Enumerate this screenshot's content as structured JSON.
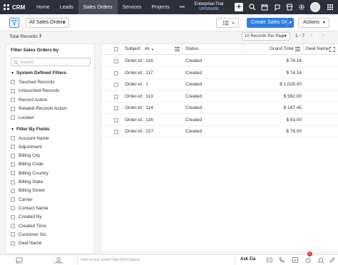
{
  "app": {
    "name": "CRM"
  },
  "nav": {
    "tabs": [
      {
        "label": "Home"
      },
      {
        "label": "Leads"
      },
      {
        "label": "Sales Orders"
      },
      {
        "label": "Services"
      },
      {
        "label": "Projects"
      },
      {
        "label": "•••"
      }
    ],
    "active_tab": "Sales Orders"
  },
  "trial": {
    "line1": "Enterprise-Trial",
    "line2": "UPGRADE"
  },
  "toolbar": {
    "view": "All Sales Orders",
    "create_label": "Create Sales Or...",
    "actions_label": "Actions"
  },
  "records": {
    "total_label": "Total Records",
    "total_count": "7",
    "per_page": "10 Records Per Page",
    "range": "1 - 7"
  },
  "sidebar": {
    "title": "Filter Sales Orders by",
    "search_placeholder": "Search",
    "system_section": "System Defined Filters",
    "system_filters": [
      {
        "label": "Touched Records"
      },
      {
        "label": "Untouched Records"
      },
      {
        "label": "Record Action"
      },
      {
        "label": "Related Records Action"
      },
      {
        "label": "Locked"
      }
    ],
    "field_section": "Filter By Fields",
    "field_filters": [
      {
        "label": "Account Name"
      },
      {
        "label": "Adjustment"
      },
      {
        "label": "Billing City"
      },
      {
        "label": "Billing Code"
      },
      {
        "label": "Billing Country"
      },
      {
        "label": "Billing State"
      },
      {
        "label": "Billing Street"
      },
      {
        "label": "Carrier"
      },
      {
        "label": "Contact Name"
      },
      {
        "label": "Created By"
      },
      {
        "label": "Created Time"
      },
      {
        "label": "Customer No."
      },
      {
        "label": "Deal Name"
      }
    ]
  },
  "table": {
    "columns": {
      "subject": "Subject",
      "subject_filter": "All",
      "status": "Status",
      "grand_total": "Grand Total",
      "deal_name": "Deal Name"
    },
    "rows": [
      {
        "subject": "Order-id : 118",
        "status": "Created",
        "total": "$ 74.16"
      },
      {
        "subject": "Order-id : 117",
        "status": "Created",
        "total": "$ 74.16"
      },
      {
        "subject": "Order-id : 1",
        "status": "Created",
        "total": "$ 1,028.00"
      },
      {
        "subject": "Order-id : 113",
        "status": "Created",
        "total": "$ 592.00"
      },
      {
        "subject": "Order-id : 114",
        "status": "Created",
        "total": "$ 147.45"
      },
      {
        "subject": "Order-id : 116",
        "status": "Created",
        "total": "$ 63.00"
      },
      {
        "subject": "Order-id : 227",
        "status": "Created",
        "total": "$ 78.00"
      }
    ]
  },
  "bottombar": {
    "chat_placeholder": "Here is your Smart Chat (Ctrl+Space)",
    "ask_zia": "Ask Zia",
    "left_labels": [
      "Chats",
      "Contacts"
    ],
    "notification_count": "1"
  },
  "colors": {
    "navbar": "#2d2f3b",
    "active_tab": "#494c5b",
    "primary": "#2f7de1",
    "upgrade": "#5ab0ff",
    "badge": "#e53935"
  }
}
